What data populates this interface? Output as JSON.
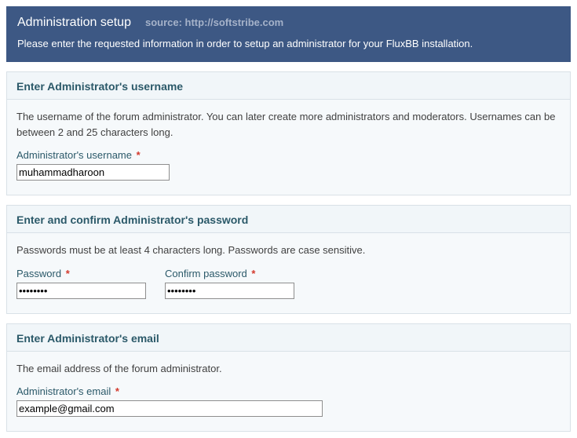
{
  "header": {
    "title": "Administration setup",
    "source": "source: http://softstribe.com",
    "description": "Please enter the requested information in order to setup an administrator for your FluxBB installation."
  },
  "sections": {
    "username": {
      "heading": "Enter Administrator's username",
      "description": "The username of the forum administrator. You can later create more administrators and moderators. Usernames can be between 2 and 25 characters long.",
      "label": "Administrator's username",
      "value": "muhammadharoon"
    },
    "password": {
      "heading": "Enter and confirm Administrator's password",
      "description": "Passwords must be at least 4 characters long. Passwords are case sensitive.",
      "label1": "Password",
      "value1": "••••••••",
      "label2": "Confirm password",
      "value2": "••••••••"
    },
    "email": {
      "heading": "Enter Administrator's email",
      "description": "The email address of the forum administrator.",
      "label": "Administrator's email",
      "value": "example@gmail.com"
    }
  },
  "required_marker": "*"
}
